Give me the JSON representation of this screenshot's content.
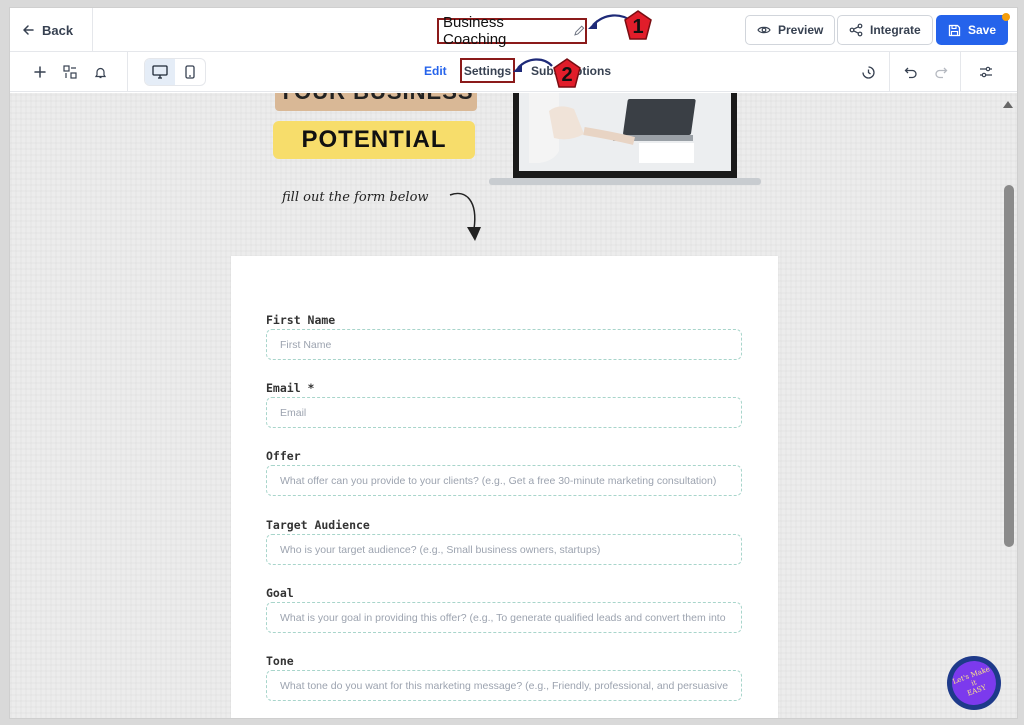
{
  "header": {
    "back_label": "Back",
    "page_title": "Business Coaching",
    "preview_label": "Preview",
    "integrate_label": "Integrate",
    "save_label": "Save"
  },
  "toolbar": {
    "tabs": [
      {
        "label": "Edit",
        "active": true
      },
      {
        "label": "Settings",
        "active": false
      },
      {
        "label": "Subscriptions",
        "active": false
      }
    ]
  },
  "annotations": {
    "badge_1": "1",
    "badge_2": "2",
    "color": "#8b1a1a"
  },
  "hero": {
    "line1": "YOUR BUSINESS",
    "line2": "POTENTIAL",
    "handwriting": "fill out the form below"
  },
  "form": {
    "fields": [
      {
        "label": "First Name",
        "placeholder": "First Name"
      },
      {
        "label": "Email *",
        "placeholder": "Email"
      },
      {
        "label": "Offer",
        "placeholder": "What offer can you provide to your clients? (e.g., Get a free 30-minute marketing consultation)"
      },
      {
        "label": "Target Audience",
        "placeholder": "Who is your target audience? (e.g., Small business owners, startups)"
      },
      {
        "label": "Goal",
        "placeholder": "What is your goal in providing this offer? (e.g., To generate qualified leads and convert them into"
      },
      {
        "label": "Tone",
        "placeholder": "What tone do you want for this marketing message? (e.g., Friendly, professional, and persuasive"
      }
    ]
  },
  "watermark": {
    "lines": [
      "Let's Make",
      "it",
      "EASY"
    ]
  },
  "colors": {
    "primary": "#2563eb",
    "field_border": "#a8d5cb",
    "highlight_yellow": "#f7dd6b",
    "highlight_tan": "#d9b896"
  }
}
